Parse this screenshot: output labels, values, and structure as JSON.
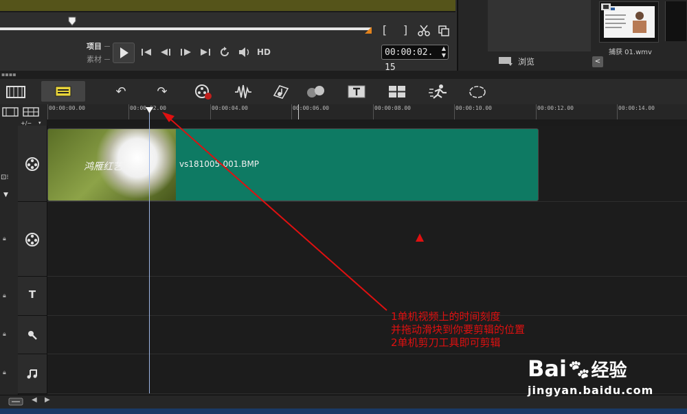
{
  "preview": {
    "label_project": "项目",
    "label_clip": "素材",
    "timecode": "00:00:02. 15",
    "hd_label": "HD"
  },
  "library": {
    "browse_label": "浏览",
    "thumb_label": "捕获 01.wmv"
  },
  "timeline": {
    "ruler_ticks": [
      "00:00:00.00",
      "00:00:02.00",
      "00:00:04.00",
      "00:00:06.00",
      "00:00:08.00",
      "00:00:10.00",
      "00:00:12.00",
      "00:00:14.00"
    ],
    "zoom_control": "+/−",
    "clip_name": "vs181005-001.BMP",
    "clip_thumb_text": "鸿雁红艺"
  },
  "annotation": {
    "lines": "1单机视频上的时间刻度\n并拖动滑块到你要剪辑的位置\n2单机剪刀工具即可剪辑",
    "color": "#e01010"
  },
  "watermark": {
    "brand": "Bai",
    "brand_cn": "经验",
    "url": "jingyan.baidu.com"
  },
  "icons": {
    "toolbar": [
      "undo-icon",
      "redo-icon",
      "record-capture-icon",
      "audio-mixer-icon",
      "auto-music-icon",
      "motion-track-icon",
      "title-icon",
      "split-screen-icon",
      "speed-icon",
      "path-icon"
    ]
  }
}
